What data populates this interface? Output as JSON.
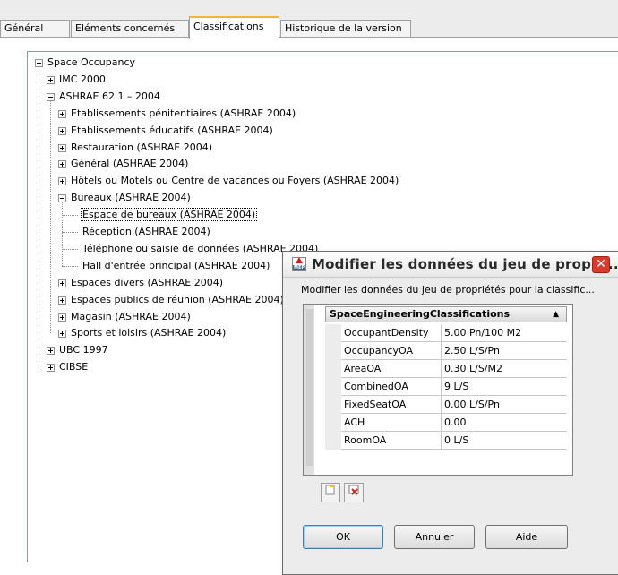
{
  "tabs": [
    "Général",
    "Eléments concernés",
    "Classifications",
    "Historique de la version"
  ],
  "active_tab": "Classifications",
  "tree": [
    {
      "label": "Space Occupancy",
      "level": 0,
      "expander": "minus"
    },
    {
      "label": "IMC 2000",
      "level": 1,
      "expander": "plus"
    },
    {
      "label": "ASHRAE 62.1 – 2004",
      "level": 1,
      "expander": "minus"
    },
    {
      "label": "Etablissements pénitentiaires (ASHRAE 2004)",
      "level": 2,
      "expander": "plus"
    },
    {
      "label": "Etablissements éducatifs (ASHRAE 2004)",
      "level": 2,
      "expander": "plus"
    },
    {
      "label": "Restauration (ASHRAE 2004)",
      "level": 2,
      "expander": "plus"
    },
    {
      "label": "Général (ASHRAE 2004)",
      "level": 2,
      "expander": "plus"
    },
    {
      "label": "Hôtels ou Motels ou Centre de vacances ou Foyers (ASHRAE 2004)",
      "level": 2,
      "expander": "plus"
    },
    {
      "label": "Bureaux (ASHRAE 2004)",
      "level": 2,
      "expander": "minus"
    },
    {
      "label": "Espace de bureaux (ASHRAE 2004)",
      "level": 3,
      "expander": "none",
      "selected": true
    },
    {
      "label": "Réception (ASHRAE 2004)",
      "level": 3,
      "expander": "none"
    },
    {
      "label": "Téléphone ou saisie de données (ASHRAE 2004)",
      "level": 3,
      "expander": "none"
    },
    {
      "label": "Hall d'entrée principal (ASHRAE 2004)",
      "level": 3,
      "expander": "none"
    },
    {
      "label": "Espaces divers (ASHRAE 2004)",
      "level": 2,
      "expander": "plus"
    },
    {
      "label": "Espaces publics de réunion (ASHRAE 2004)",
      "level": 2,
      "expander": "plus"
    },
    {
      "label": "Magasin (ASHRAE 2004)",
      "level": 2,
      "expander": "plus"
    },
    {
      "label": "Sports et loisirs (ASHRAE 2004)",
      "level": 2,
      "expander": "plus"
    },
    {
      "label": "UBC 1997",
      "level": 1,
      "expander": "plus"
    },
    {
      "label": "CIBSE",
      "level": 1,
      "expander": "plus"
    }
  ],
  "dialog": {
    "title": "Modifier les données du jeu de propri...",
    "app_icon_text": "MEP",
    "close_glyph": "✕",
    "description": "Modifier les données du jeu de propriétés pour la classific...",
    "grid_header": "SpaceEngineeringClassifications",
    "sort_glyph": "▲",
    "rows": [
      {
        "name": "OccupantDensity",
        "value": "5.00 Pn/100 M2"
      },
      {
        "name": "OccupancyOA",
        "value": "2.50  L/S/Pn"
      },
      {
        "name": "AreaOA",
        "value": "0.30 L/S/M2"
      },
      {
        "name": "CombinedOA",
        "value": "9 L/S"
      },
      {
        "name": "FixedSeatOA",
        "value": "0.00  L/S/Pn"
      },
      {
        "name": "ACH",
        "value": "0.00"
      },
      {
        "name": "RoomOA",
        "value": "0 L/S"
      }
    ],
    "buttons": {
      "ok": "OK",
      "cancel": "Annuler",
      "help": "Aide"
    }
  }
}
